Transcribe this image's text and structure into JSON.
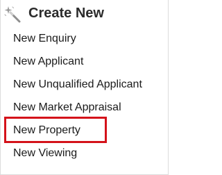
{
  "header": {
    "icon": "magic-wand-icon",
    "title": "Create New"
  },
  "menu": {
    "items": [
      {
        "label": "New Enquiry"
      },
      {
        "label": "New Applicant"
      },
      {
        "label": "New Unqualified Applicant"
      },
      {
        "label": "New Market Appraisal"
      },
      {
        "label": "New Property",
        "highlighted": true
      },
      {
        "label": "New Viewing"
      }
    ]
  },
  "colors": {
    "highlight_border": "#d4121a",
    "title_text": "#2b2b2b",
    "item_text": "#1a1a1a"
  }
}
